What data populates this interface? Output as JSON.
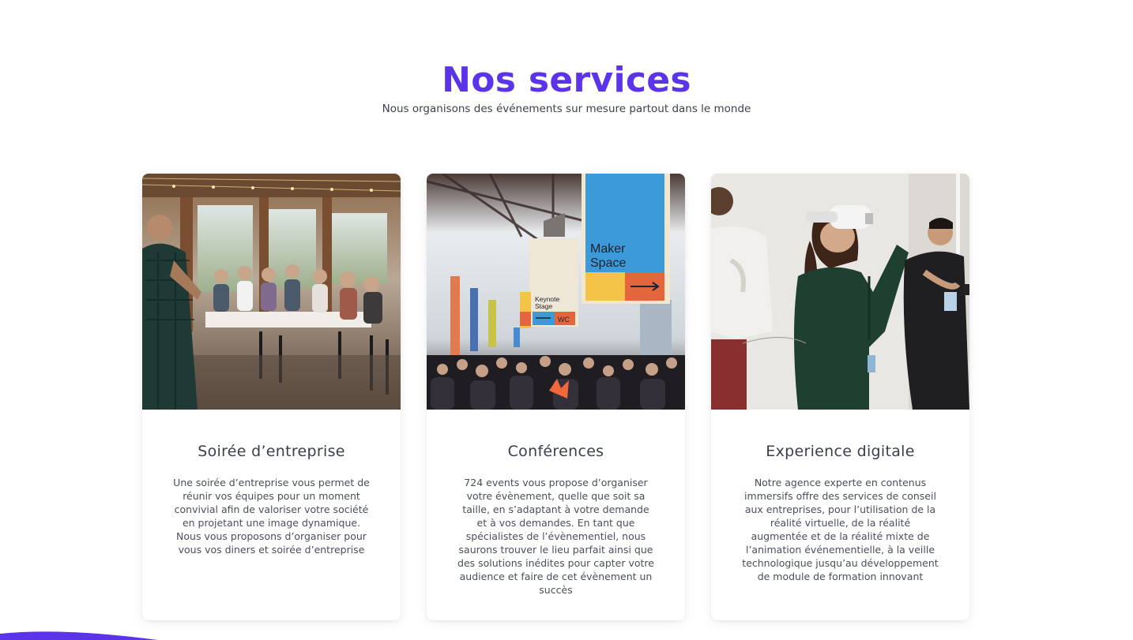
{
  "section": {
    "title": "Nos services",
    "subtitle": "Nous organisons des événements sur mesure partout dans le monde"
  },
  "cards": [
    {
      "title": "Soirée d’entreprise",
      "text": "Une soirée d’entreprise vous permet de réunir vos équipes pour un moment convivial afin de valoriser votre société en projetant une image dynamique. Nous vous proposons d’organiser pour vous vos diners et soirée d’entreprise"
    },
    {
      "title": "Conférences",
      "text": "724 events vous propose d’organiser votre évènement, quelle que soit sa taille, en s’adaptant à votre demande et à vos demandes. En tant que spécialistes de l’évènementiel, nous saurons trouver le lieu parfait ainsi que des solutions inédites pour capter votre audience et faire de cet évènement un succès",
      "signs": {
        "big": "Maker Space",
        "small": "Keynote Stage",
        "wc": "WC"
      }
    },
    {
      "title": "Experience digitale",
      "text": "Notre agence experte en contenus immersifs offre des services de conseil aux entreprises, pour l’utilisation de la réalité virtuelle, de la réalité augmentée et de la réalité mixte de l’animation événementielle, à la veille technologique jusqu’au développement de module de formation innovant"
    }
  ],
  "colors": {
    "accent": "#5b34ea",
    "text": "#3b3f4a"
  }
}
